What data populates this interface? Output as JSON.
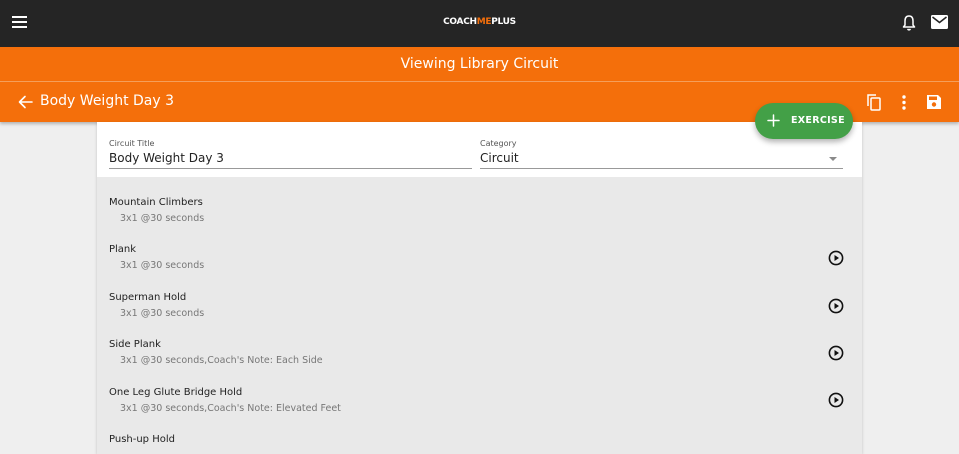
{
  "app": {
    "logo_left": "COACH",
    "logo_accent": "ME",
    "logo_right": "PLUS"
  },
  "banner": {
    "text": "Viewing Library Circuit"
  },
  "header": {
    "title": "Body Weight Day 3"
  },
  "form": {
    "circuit_title_label": "Circuit Title",
    "circuit_title_value": "Body Weight Day 3",
    "category_label": "Category",
    "category_value": "Circuit"
  },
  "fab": {
    "label": "EXERCISE"
  },
  "exercises": [
    {
      "name": "Mountain Climbers",
      "detail": "3x1 @30 seconds",
      "has_video": false
    },
    {
      "name": "Plank",
      "detail": "3x1 @30 seconds",
      "has_video": true
    },
    {
      "name": "Superman Hold",
      "detail": "3x1 @30 seconds",
      "has_video": true
    },
    {
      "name": "Side Plank",
      "detail": "3x1 @30 seconds,Coach's Note: Each Side",
      "has_video": true
    },
    {
      "name": "One Leg Glute Bridge Hold",
      "detail": "3x1 @30 seconds,Coach's Note: Elevated Feet",
      "has_video": true
    },
    {
      "name": "Push-up Hold",
      "detail": "",
      "has_video": false
    }
  ],
  "icons": {
    "menu": "hamburger-icon",
    "notifications": "bell-icon",
    "messages": "mail-icon",
    "back": "arrow-left-icon",
    "copy": "copy-icon",
    "more": "more-vertical-icon",
    "save": "save-icon",
    "play": "play-circle-icon",
    "add": "plus-icon"
  },
  "colors": {
    "topbar": "#252525",
    "brand_orange": "#f46f0b",
    "fab_green": "#43a047",
    "card_bg": "#e9e9e9"
  }
}
